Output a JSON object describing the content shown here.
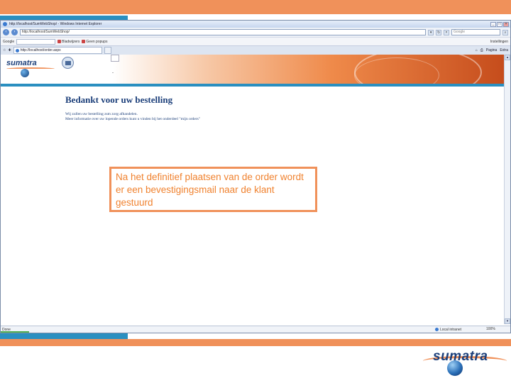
{
  "slide": {
    "colors": {
      "accent_orange": "#f0915a",
      "accent_blue": "#2a8fc0",
      "brand_navy": "#1c3f7a"
    }
  },
  "browser": {
    "title": "http://localhost/SumWebShop/ - Windows Internet Explorer",
    "address_url": "http://localhost/SumWebShop/",
    "search_placeholder": "Google",
    "google_toolbar": {
      "label": "Google",
      "items": [
        "Bladwijzers",
        "Geen popups"
      ],
      "right_label": "Instellingen"
    },
    "tab_title": "http://localhost/order.aspx",
    "tab_tools": [
      "Pagina",
      "Extra"
    ],
    "status": {
      "text": "Done",
      "zone": "Local intranet",
      "zoom": "100%"
    }
  },
  "page": {
    "site_logo": "sumatra",
    "site_dot": "-",
    "heading": "Bedankt voor uw bestelling",
    "line1": "Wij zullen uw bestelling zsm zorg afhandelen.",
    "line2": "Meer informatie over uw lopende orders kunt u vinden bij het onderdeel \"mijn orders\""
  },
  "callout": {
    "text": "Na het definitief plaatsen van de order wordt er een bevestigingsmail naar de klant gestuurd"
  },
  "brand": {
    "name": "sumatra"
  }
}
